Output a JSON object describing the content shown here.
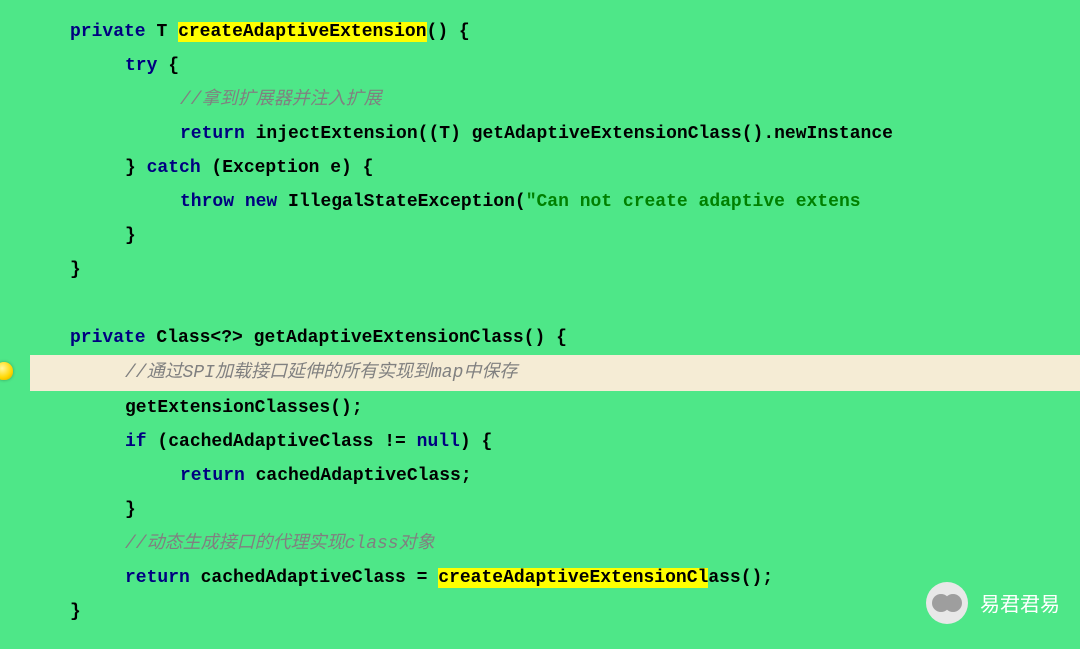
{
  "code": {
    "l1": {
      "kw_private": "private",
      "type_T": "T",
      "hl": "createAdaptiveExtension",
      "paren_brace": "() {"
    },
    "l2": {
      "kw_try": "try",
      "brace": " {"
    },
    "l3": {
      "comment": "//拿到扩展器并注入扩展"
    },
    "l4": {
      "kw_return": "return",
      "inject": " injectExtension((",
      "type_T": "T",
      "rest": ") getAdaptiveExtensionClass().newInstance"
    },
    "l5": {
      "rbrace": "} ",
      "kw_catch": "catch",
      "params": " (Exception e) {"
    },
    "l6": {
      "kw_throw": "throw",
      "kw_new": " new",
      "cls": " IllegalStateException(",
      "str": "\"Can not create adaptive extens"
    },
    "l7": {
      "rbrace": "}"
    },
    "l8": {
      "rbrace": "}"
    },
    "l10": {
      "kw_private": "private",
      "cls": " Class<?> getAdaptiveExtensionClass() {"
    },
    "l11": {
      "comment": "//通过SPI加载接口延伸的所有实现到map中保存"
    },
    "l12": {
      "call": "getExtensionClasses();"
    },
    "l13": {
      "kw_if": "if",
      "cond_pre": " (cachedAdaptiveClass != ",
      "kw_null": "null",
      "cond_post": ") {"
    },
    "l14": {
      "kw_return": "return",
      "expr": " cachedAdaptiveClass;"
    },
    "l15": {
      "rbrace": "}"
    },
    "l16": {
      "comment": "//动态生成接口的代理实现class对象"
    },
    "l17": {
      "kw_return": "return",
      "expr": " cachedAdaptiveClass = ",
      "hl": "createAdaptiveExtensionCl",
      "rest": "ass();"
    },
    "l18": {
      "rbrace": "}"
    }
  },
  "watermark": {
    "text": "易君君易"
  }
}
